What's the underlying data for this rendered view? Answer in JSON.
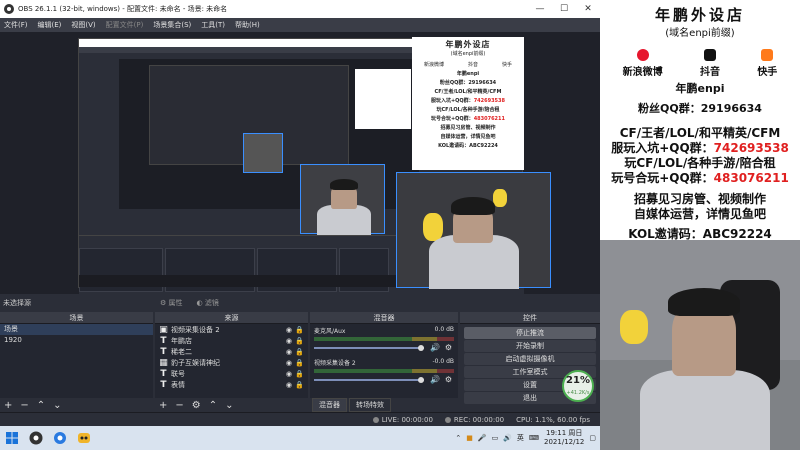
{
  "window": {
    "title": "OBS 26.1.1 (32-bit, windows) - 配置文件: 未命名 - 场景: 未命名",
    "controls": [
      "—",
      "☐",
      "✕"
    ]
  },
  "menu": [
    "文件(F)",
    "编辑(E)",
    "视图(V)",
    "配置文件(P)",
    "场景集合(S)",
    "工具(T)",
    "帮助(H)"
  ],
  "status_line": {
    "no_source": "未选择源",
    "properties": "属性",
    "filters": "滤镜"
  },
  "scenes": {
    "header": "场景",
    "items": [
      "场景",
      "1920"
    ]
  },
  "sources": {
    "header": "来源",
    "items": [
      {
        "type": "camera",
        "name": "视频采集设备 2"
      },
      {
        "type": "text",
        "name": "年鹏店"
      },
      {
        "type": "text",
        "name": "稀老二"
      },
      {
        "type": "image",
        "name": "豹子互娱请神纪"
      },
      {
        "type": "text",
        "name": "联号"
      },
      {
        "type": "text",
        "name": "表情"
      }
    ]
  },
  "mixer": {
    "header": "混音器",
    "channels": [
      {
        "name": "麦克风/Aux",
        "db": "0.0 dB"
      },
      {
        "name": "视频采集设备 2",
        "db": "-0.0 dB"
      }
    ],
    "tabs": [
      "混音器",
      "转场特效"
    ]
  },
  "controls": {
    "header": "控件",
    "buttons": [
      "停止推流",
      "开始录制",
      "启动虚拟摄像机",
      "工作室模式",
      "设置",
      "退出"
    ]
  },
  "statusbar": {
    "live": "LIVE: 00:00:00",
    "rec": "REC: 00:00:00",
    "cpu": "CPU: 1.1%, 60.00 fps"
  },
  "cpu_badge": {
    "percent": "21%",
    "sub": "+41.2K/s"
  },
  "taskbar": {
    "time": "19:11 周日",
    "date": "2021/12/12",
    "ime": "英"
  },
  "overlay": {
    "title": "年鹏外设店",
    "subtitle": "(域名enpi前缀)",
    "socials": [
      {
        "label": "新浪微博",
        "color": "#e6162d"
      },
      {
        "label": "抖音",
        "color": "#111111"
      },
      {
        "label": "快手",
        "color": "#ff7a1a"
      }
    ],
    "handle": "年鹏enpi",
    "qq_group": "粉丝QQ群：29196634",
    "lines": [
      {
        "text": "CF/王者/LOL/和平精英/CFM",
        "red": ""
      },
      {
        "text": "服玩入坑+QQ群：",
        "red": "742693538"
      },
      {
        "text": "玩CF/LOL/各种手游/陪合租",
        "red": ""
      },
      {
        "text": "玩号合玩+QQ群：",
        "red": "483076211"
      },
      {
        "text": "招募见习房管、视频制作",
        "red": ""
      },
      {
        "text": "自媒体运营，详情见鱼吧",
        "red": ""
      },
      {
        "text": "KOL邀请码：ABC92224",
        "red": ""
      }
    ]
  }
}
